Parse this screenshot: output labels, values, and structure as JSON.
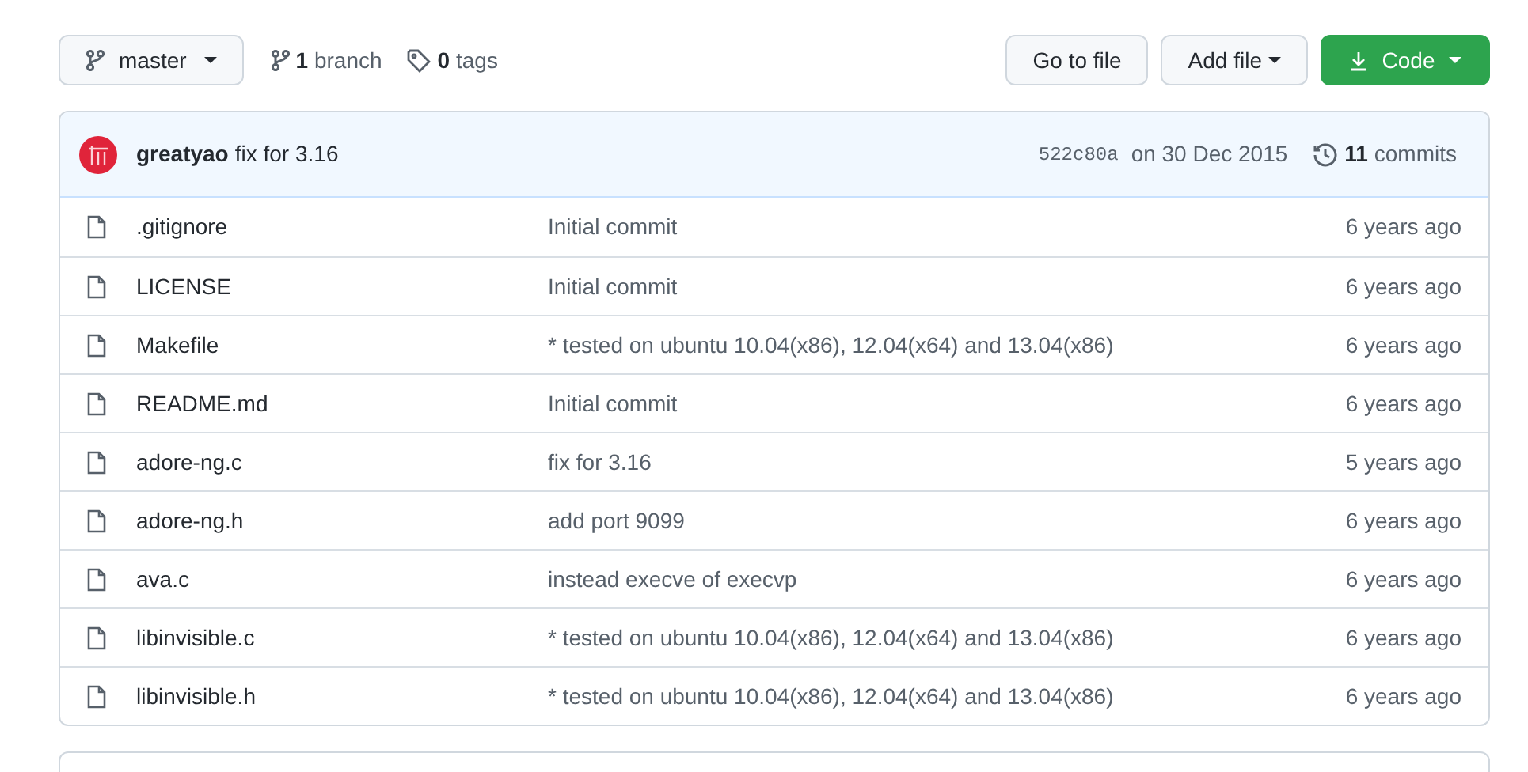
{
  "toolbar": {
    "branch_button": "master",
    "branches": {
      "count": "1",
      "label": "branch"
    },
    "tags": {
      "count": "0",
      "label": "tags"
    },
    "go_to_file": "Go to file",
    "add_file": "Add file",
    "code": "Code"
  },
  "latest_commit": {
    "author": "greatyao",
    "message": "fix for 3.16",
    "sha": "522c80a",
    "date": "on 30 Dec 2015",
    "commits_count": "11",
    "commits_label": "commits"
  },
  "files": [
    {
      "name": ".gitignore",
      "message": "Initial commit",
      "age": "6 years ago"
    },
    {
      "name": "LICENSE",
      "message": "Initial commit",
      "age": "6 years ago"
    },
    {
      "name": "Makefile",
      "message": "* tested on ubuntu 10.04(x86), 12.04(x64) and 13.04(x86)",
      "age": "6 years ago"
    },
    {
      "name": "README.md",
      "message": "Initial commit",
      "age": "6 years ago"
    },
    {
      "name": "adore-ng.c",
      "message": "fix for 3.16",
      "age": "5 years ago"
    },
    {
      "name": "adore-ng.h",
      "message": "add port 9099",
      "age": "6 years ago"
    },
    {
      "name": "ava.c",
      "message": "instead execve of execvp",
      "age": "6 years ago"
    },
    {
      "name": "libinvisible.c",
      "message": "* tested on ubuntu 10.04(x86), 12.04(x64) and 13.04(x86)",
      "age": "6 years ago"
    },
    {
      "name": "libinvisible.h",
      "message": "* tested on ubuntu 10.04(x86), 12.04(x64) and 13.04(x86)",
      "age": "6 years ago"
    }
  ]
}
